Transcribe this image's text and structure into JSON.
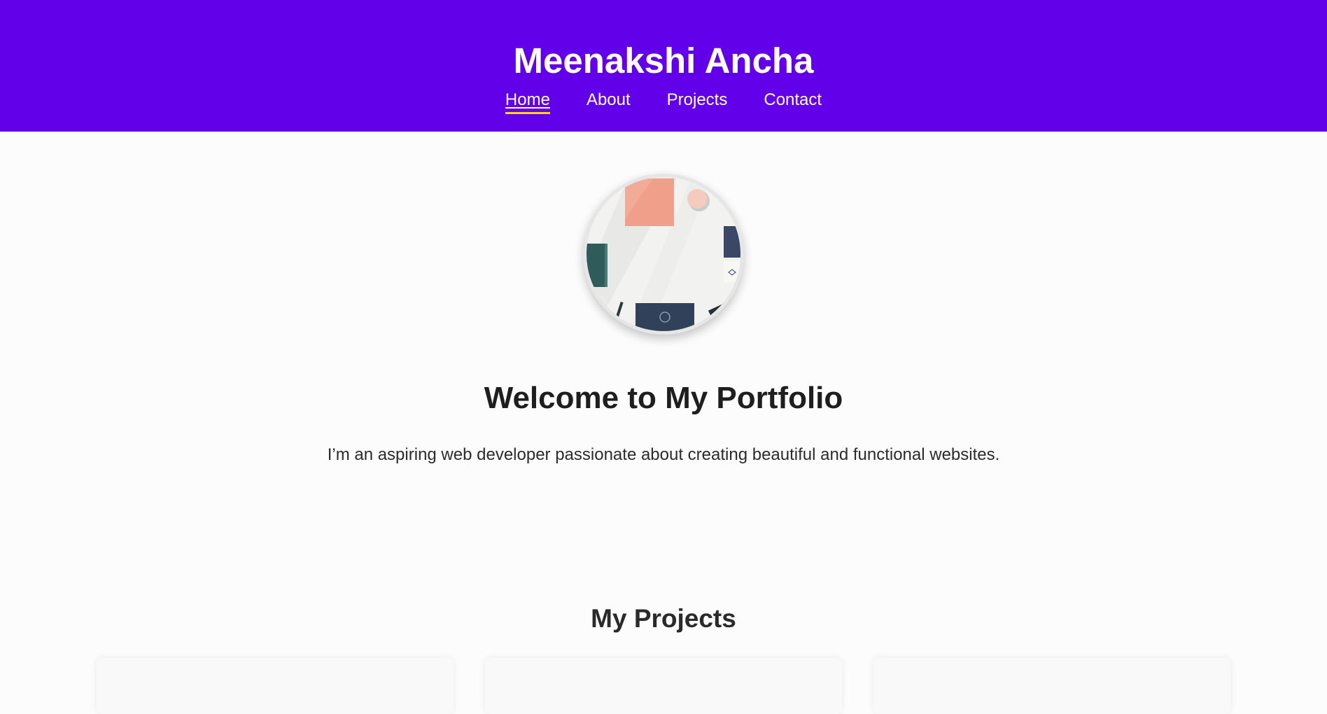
{
  "header": {
    "title": "Meenakshi Ancha",
    "background_color": "#6200ea",
    "nav": [
      {
        "label": "Home",
        "active": true
      },
      {
        "label": "About",
        "active": false
      },
      {
        "label": "Projects",
        "active": false
      },
      {
        "label": "Contact",
        "active": false
      }
    ],
    "active_underline_color": "#ffd600"
  },
  "hero": {
    "avatar": "desk-flatlay-image",
    "title": "Welcome to My Portfolio",
    "text": "I’m an aspiring web developer passionate about creating beautiful and functional websites."
  },
  "projects": {
    "title": "My Projects",
    "cards": [
      {
        "name": "project-card-1"
      },
      {
        "name": "project-card-2"
      },
      {
        "name": "project-card-3"
      }
    ]
  }
}
